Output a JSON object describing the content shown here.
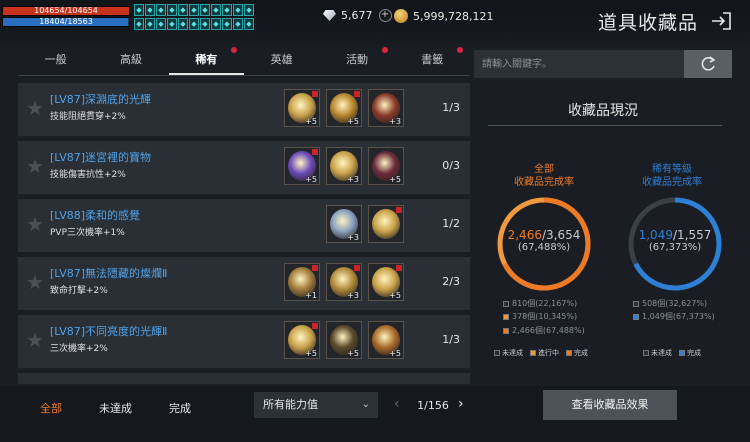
{
  "player": {
    "hp": "104654/104654",
    "hp_fraction": 1.0,
    "mp": "18404/18563",
    "mp_fraction": 0.991
  },
  "buff_icons": [
    "buff-icon",
    "buff-icon",
    "buff-icon",
    "buff-icon",
    "buff-icon",
    "buff-icon",
    "buff-icon",
    "buff-icon",
    "buff-icon",
    "buff-icon",
    "buff-icon",
    "buff-icon",
    "buff-icon",
    "buff-icon",
    "buff-icon",
    "buff-icon",
    "buff-icon",
    "buff-icon",
    "buff-icon",
    "buff-icon",
    "buff-icon",
    "buff-icon"
  ],
  "currency": {
    "diamonds": "5,677",
    "gold": "5,999,728,121"
  },
  "header": {
    "title": "道具收藏品"
  },
  "tabs": [
    {
      "label": "一般",
      "active": false,
      "dot": false
    },
    {
      "label": "高級",
      "active": false,
      "dot": false
    },
    {
      "label": "稀有",
      "active": true,
      "dot": true
    },
    {
      "label": "英雄",
      "active": false,
      "dot": false
    },
    {
      "label": "活動",
      "active": false,
      "dot": true
    },
    {
      "label": "書籤",
      "active": false,
      "dot": true
    }
  ],
  "search": {
    "placeholder": "請輸入關鍵字。"
  },
  "collections": [
    {
      "name": "[LV87]深淵底的光輝",
      "effect": "技能阻絕貫穿+2%",
      "progress": "1/3",
      "items": [
        {
          "count": "+5",
          "marked": true,
          "color": "#c9a24a"
        },
        {
          "count": "+5",
          "marked": true,
          "color": "#b8862e"
        },
        {
          "count": "+3",
          "marked": false,
          "color": "#8a3a2a"
        }
      ]
    },
    {
      "name": "[LV87]迷宮裡的寶物",
      "effect": "技能傷害抗性+2%",
      "progress": "0/3",
      "items": [
        {
          "count": "+5",
          "marked": true,
          "color": "#6a4ab8"
        },
        {
          "count": "+3",
          "marked": false,
          "color": "#c9a24a"
        },
        {
          "count": "+5",
          "marked": false,
          "color": "#6a2a3a"
        }
      ]
    },
    {
      "name": "[LV88]柔和的感覺",
      "effect": "PVP三次機率+1%",
      "progress": "1/2",
      "items": [
        {
          "count": "+3",
          "marked": false,
          "color": "#8aa0c0"
        },
        {
          "count": "",
          "marked": true,
          "color": "#c9a24a"
        }
      ]
    },
    {
      "name": "[LV87]無法隱藏的燦爛Ⅱ",
      "effect": "致命打擊+2%",
      "progress": "2/3",
      "items": [
        {
          "count": "+1",
          "marked": true,
          "color": "#a07a3a"
        },
        {
          "count": "+3",
          "marked": true,
          "color": "#b08a3a"
        },
        {
          "count": "+5",
          "marked": true,
          "color": "#c9a24a"
        }
      ]
    },
    {
      "name": "[LV87]不同亮度的光輝Ⅱ",
      "effect": "三次機率+2%",
      "progress": "1/3",
      "items": [
        {
          "count": "+5",
          "marked": true,
          "color": "#c9a24a"
        },
        {
          "count": "+5",
          "marked": false,
          "color": "#5a4a2a"
        },
        {
          "count": "+5",
          "marked": false,
          "color": "#a86a2a"
        }
      ]
    }
  ],
  "status": {
    "title": "收藏品現況",
    "total": {
      "label_line1": "全部",
      "label_line2": "收藏品完成率",
      "done": "2,466",
      "total": "/3,654",
      "percent": "(67,488%)",
      "fraction": 0.67488,
      "legend": [
        "810個(22,167%)",
        "378個(10,345%)",
        "2,466個(67,488%)"
      ],
      "colors": {
        "fill": "#ee7a26",
        "track": "#ef9a3f"
      }
    },
    "rare": {
      "label_line1": "稀有等級",
      "label_line2": "收藏品完成率",
      "done": "1,049",
      "total": "/1,557",
      "percent": "(67,373%)",
      "fraction": 0.67373,
      "legend": [
        "508個(32,627%)",
        "1,049個(67,373%)"
      ],
      "colors": {
        "fill": "#2e7fd6",
        "track": "#3a4048"
      }
    },
    "keys_total": [
      "未達成",
      "進行中",
      "完成"
    ],
    "keys_rare": [
      "未達成",
      "完成"
    ]
  },
  "footer": {
    "filters": [
      "全部",
      "未達成",
      "完成"
    ],
    "dropdown": "所有能力值",
    "page": "1/156",
    "effect_button": "查看收藏品效果"
  },
  "colors": {
    "accent_orange": "#ee7a26",
    "accent_blue": "#2e7fd6",
    "name_blue": "#4fa2e8",
    "tab_dot": "#d6263c"
  }
}
